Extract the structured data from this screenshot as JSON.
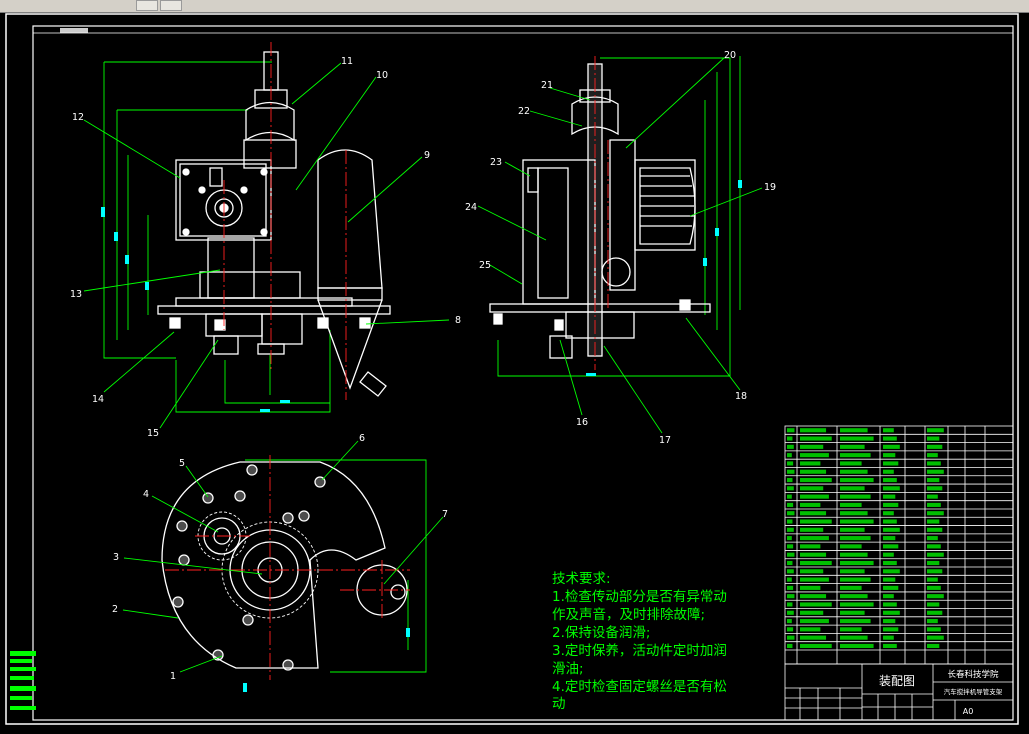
{
  "callouts": [
    "1",
    "2",
    "3",
    "4",
    "5",
    "6",
    "7",
    "8",
    "9",
    "10",
    "11",
    "12",
    "13",
    "14",
    "15",
    "16",
    "17",
    "18",
    "19",
    "20",
    "21",
    "22",
    "23",
    "24",
    "25"
  ],
  "tech_requirements": {
    "title": "技术要求:",
    "lines": [
      "1.检查传动部分是否有异常动",
      "作及声音，及时排除故障;",
      "2.保持设备润滑;",
      "3.定时保养，活动件定时加润",
      "滑油;",
      "4.定时检查固定螺丝是否有松",
      "动"
    ]
  },
  "title_block": {
    "drawing_name": "装配图",
    "school": "长春科技学院",
    "subtitle": "汽车搅拌机导管支架",
    "sheet_size": "A0"
  },
  "colors": {
    "frame": "#ffffff",
    "outline": "#ffffff",
    "centerline": "#ff2020",
    "dimension": "#00ff00",
    "hidden": "#00ffff",
    "text_green": "#00ff00"
  }
}
